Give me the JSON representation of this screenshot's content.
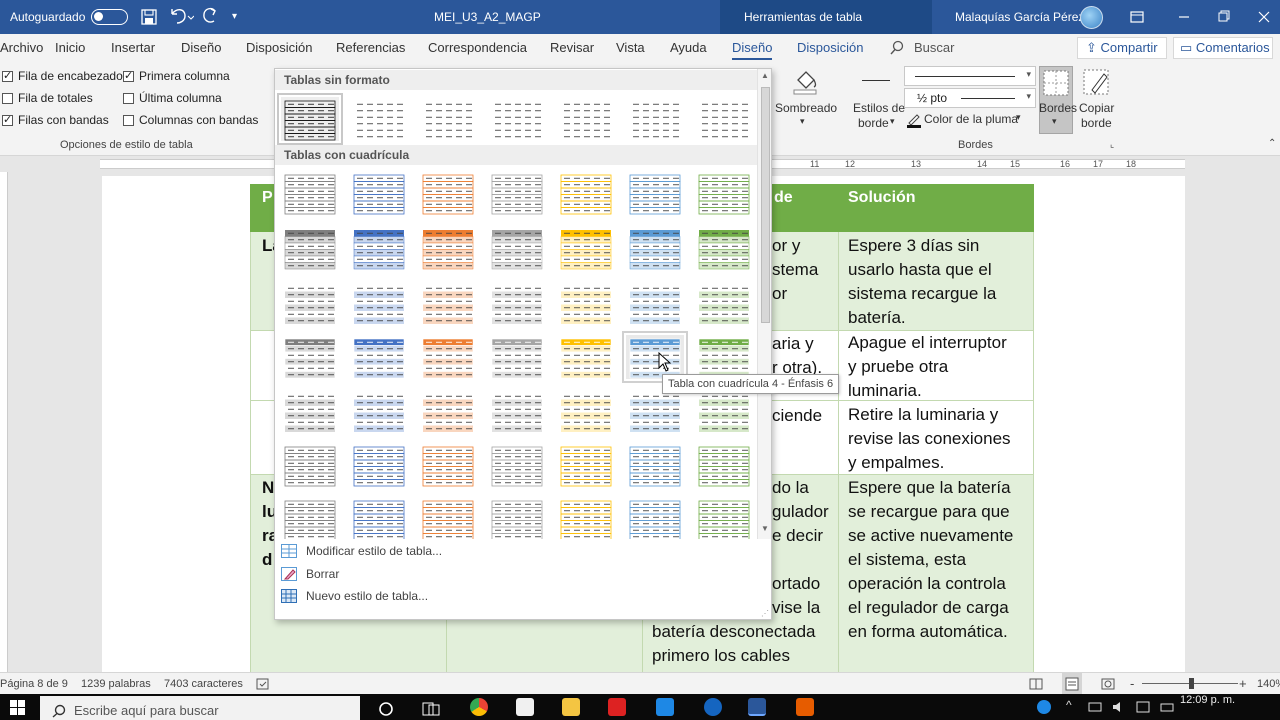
{
  "titlebar": {
    "autosave_label": "Autoguardado",
    "doc_title": "MEI_U3_A2_MAGP",
    "context_tab": "Herramientas de tabla",
    "user_name": "Malaquías García Pérez"
  },
  "tabs": {
    "items": [
      "Archivo",
      "Inicio",
      "Insertar",
      "Diseño",
      "Disposición",
      "Referencias",
      "Correspondencia",
      "Revisar",
      "Vista",
      "Ayuda",
      "Diseño",
      "Disposición"
    ],
    "search": "Buscar",
    "share": "Compartir",
    "comments": "Comentarios"
  },
  "ribbon": {
    "options": {
      "header_row": "Fila de encabezado",
      "first_column": "Primera columna",
      "total_row": "Fila de totales",
      "last_column": "Última columna",
      "banded_rows": "Filas con bandas",
      "banded_columns": "Columnas con bandas",
      "group_label": "Opciones de estilo de tabla",
      "header_row_checked": true,
      "first_column_checked": true,
      "total_row_checked": false,
      "last_column_checked": false,
      "banded_rows_checked": true,
      "banded_columns_checked": false
    },
    "shading": "Sombreado",
    "border_styles_1": "Estilos de",
    "border_styles_2": "borde",
    "pen_weight": "½ pto",
    "pen_color": "Color de la pluma",
    "borders": "Bordes",
    "copy_border_1": "Copiar",
    "copy_border_2": "borde",
    "borders_group": "Bordes"
  },
  "ruler": {
    "labels": [
      "11",
      "12",
      "13",
      "14",
      "15",
      "16",
      "17",
      "18"
    ]
  },
  "gallery": {
    "plain_header": "Tablas sin formato",
    "grid_header": "Tablas con cuadrícula",
    "tooltip": "Tabla con cuadrícula 4 - Énfasis 6",
    "menu": {
      "modify": "Modificar estilo de tabla...",
      "clear": "Borrar",
      "new": "Nuevo estilo de tabla..."
    },
    "accent_colors": [
      "#7f7f7f",
      "#4472c4",
      "#ed7d31",
      "#a5a5a5",
      "#ffc000",
      "#5b9bd5",
      "#70ad47"
    ]
  },
  "document": {
    "header_color": "#70ad47",
    "band_color": "#e2efda",
    "col1_header": "P",
    "col3_header": "de",
    "col4_header": "Solución",
    "col1_frags": [
      "La",
      "N",
      "lu",
      "ra",
      "d"
    ],
    "col3_frags": [
      "or y",
      "stema",
      "or",
      "aria y",
      "r otra).",
      "ciende",
      "do la",
      "gulador",
      "e decir",
      "ortado",
      "vise la",
      "batería desconectada",
      "primero los cables"
    ],
    "col4_lines": [
      "Espere 3 días sin",
      "usarlo hasta que el",
      "sistema recargue la",
      "batería.",
      "Apague el interruptor",
      "y pruebe otra",
      "luminaria.",
      "Retire la luminaria y",
      "revise las conexiones",
      "y empalmes.",
      "Espere que la batería",
      "se recargue para que",
      "se active nuevamente",
      "el sistema, esta",
      "operación la controla",
      "el regulador de carga",
      "en forma automática."
    ]
  },
  "statusbar": {
    "page": "Página 8 de 9",
    "words": "1239 palabras",
    "chars": "7403 caracteres",
    "zoom_minus": "-",
    "zoom_plus": "+",
    "zoom": "140%"
  },
  "taskbar": {
    "search_placeholder": "Escribe aquí para buscar",
    "time": "12:09 p. m."
  }
}
